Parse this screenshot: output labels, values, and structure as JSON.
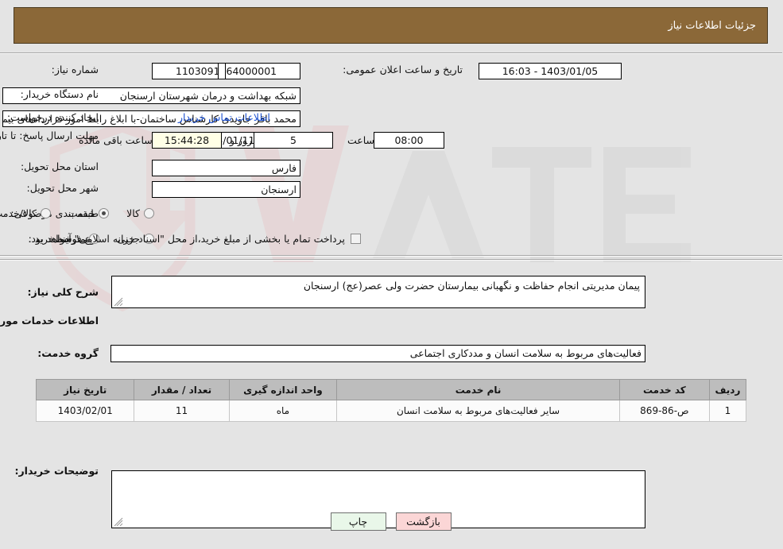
{
  "header": {
    "title": "جزئیات اطلاعات نیاز"
  },
  "form": {
    "need_number_label": "شماره نیاز:",
    "need_number_value": "1103091364000001",
    "announce_label": "تاریخ و ساعت اعلان عمومی:",
    "announce_value": "1403/01/05 - 16:03",
    "buyer_org_label": "نام دستگاه خریدار:",
    "buyer_org_value": "شبکه بهداشت و درمان شهرستان ارسنجان",
    "creator_label": "ایجاد کننده درخواست:",
    "creator_value": "محمد باقر جاویدی کارشناس ساختمان-با ابلاغ رابط امور قراردادهای بیمارستان ش",
    "contact_link": "اطلاعات تماس خریدار",
    "deadline_label": "مهلت ارسال پاسخ: تا تاریخ:",
    "deadline_date": "1403/01/11",
    "time_label": "ساعت",
    "time_value": "08:00",
    "days_value": "5",
    "days_label": "روز و",
    "countdown_value": "15:44:28",
    "remaining_label": "ساعت باقی مانده",
    "province_label": "استان محل تحویل:",
    "province_value": "فارس",
    "city_label": "شهر محل تحویل:",
    "city_value": "ارسنجان",
    "category_label": "طبقه بندی موضوعی:",
    "category_options": [
      {
        "label": "کالا",
        "checked": false
      },
      {
        "label": "خدمت",
        "checked": true
      },
      {
        "label": "کالا/خدمت",
        "checked": false
      }
    ],
    "purchase_label": "نوع فرآیند خرید :",
    "purchase_options": [
      {
        "label": "جزیی",
        "checked": false
      },
      {
        "label": "متوسط",
        "checked": false
      }
    ],
    "treasury_checkbox_label": "پرداخت تمام یا بخشی از مبلغ خرید،از محل \"اسناد خزانه اسلامی\" خواهد بود.",
    "treasury_checked": false
  },
  "description": {
    "label": "شرح کلی نیاز:",
    "value": "پیمان مدیریتی انجام حفاظت و نگهبانی بیمارستان حضرت ولی عصر(عج) ارسنجان"
  },
  "services": {
    "section_title": "اطلاعات خدمات مورد نیاز",
    "group_label": "گروه خدمت:",
    "group_value": "فعالیت‌های مربوط به سلامت انسان و مددکاری اجتماعی",
    "columns": [
      "ردیف",
      "کد خدمت",
      "نام خدمت",
      "واحد اندازه گیری",
      "تعداد / مقدار",
      "تاریخ نیاز"
    ],
    "rows": [
      {
        "row": "1",
        "code": "ص-86-869",
        "name": "سایر فعالیت‌های مربوط به سلامت انسان",
        "unit": "ماه",
        "qty": "11",
        "date": "1403/02/01"
      }
    ]
  },
  "buyer_notes": {
    "label": "توضیحات خریدار:",
    "value": ""
  },
  "buttons": {
    "print": "چاپ",
    "back": "بازگشت"
  },
  "colors": {
    "header_bg": "#8b6838",
    "page_bg": "#e4e4e4",
    "link": "#1a4fd0",
    "table_header_bg": "#bdbdbd",
    "countdown_bg": "#ffffe6",
    "print_btn_bg": "#e9f7e9",
    "back_btn_bg": "#fbd6d6"
  }
}
